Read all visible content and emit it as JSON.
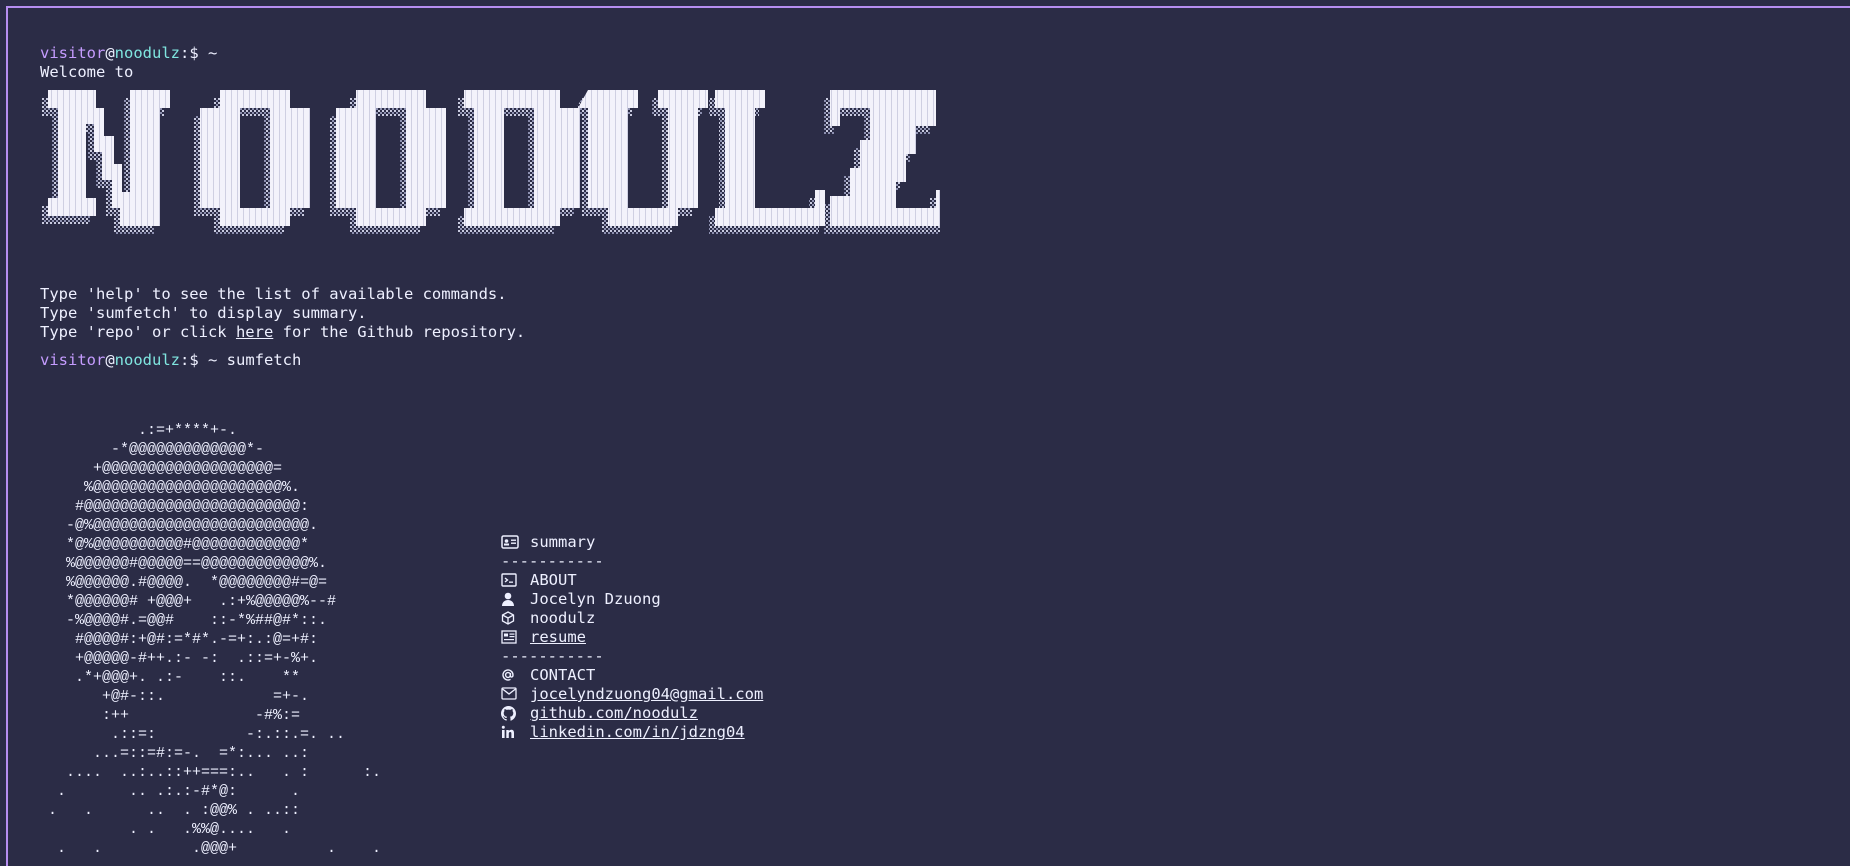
{
  "prompt": {
    "user": "visitor",
    "at": "@",
    "host": "noodulz",
    "suffix": ":$ ~"
  },
  "welcome": "Welcome to",
  "banner_text": "NOODULZ",
  "info_lines": [
    "Type 'help' to see the list of available commands.",
    "Type 'sumfetch' to display summary."
  ],
  "repo_line": {
    "before": "Type 'repo' or click ",
    "link": "here",
    "after": " for the Github repository."
  },
  "command2": "sumfetch",
  "ascii_art": "          .:=+****+-.\n       -*@@@@@@@@@@@@@*-\n     +@@@@@@@@@@@@@@@@@@@=\n    %@@@@@@@@@@@@@@@@@@@@@%.\n   #@@@@@@@@@@@@@@@@@@@@@@@@:\n  -@%@@@@@@@@@@@@@@@@@@@@@@@@.\n  *@%@@@@@@@@@@#@@@@@@@@@@@@*\n  %@@@@@@#@@@@@==@@@@@@@@@@@@%.\n  %@@@@@@.#@@@@.  *@@@@@@@@#=@=\n  *@@@@@@# +@@@+   .:+%@@@@@%--#\n  -%@@@@#.=@@#    ::-*%##@#*::.\n   #@@@@#:+@#:=*#*.-=+:.:@=+#:\n   +@@@@@-#++.:- -:  .::=+-%+.\n   .*+@@@+. .:-    ::.    **\n      +@#-::.            =+-.\n      :++              -#%:=\n       .::=:          -:.::.=. ..\n     ...=::=#:=-.  =*:... ..:\n  ....  ..:..::++===:..   . :      :.\n .       .. .:.:-#*@:      .\n.   .      ..  . :@@% . ..::\n         . .   .%%@....   .\n .   .          .@@@+          .    .",
  "summary": {
    "title": "summary",
    "separator": "-----------",
    "about_title": "ABOUT",
    "name": "Jocelyn Dzuong",
    "handle": "noodulz",
    "resume": "resume",
    "contact_title": "CONTACT",
    "email": "jocelyndzuong04@gmail.com",
    "github": "github.com/noodulz",
    "linkedin": "linkedin.com/in/jdzng04"
  },
  "colors": {
    "background": "#2b2c46",
    "user": "#c59cff",
    "host": "#80e6e0",
    "text": "#eef0ff",
    "border": "#b68ef0"
  }
}
